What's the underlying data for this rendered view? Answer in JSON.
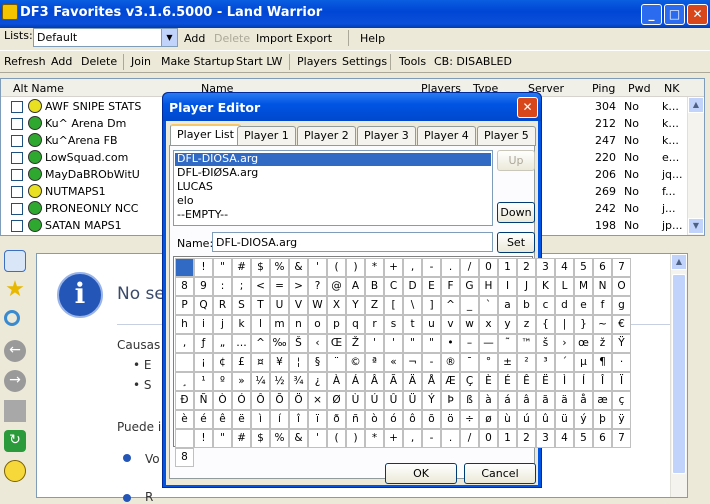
{
  "title": "DF3 Favorites v3.1.6.5000 - Land Warrior",
  "lists": {
    "label": "Lists:",
    "value": "Default",
    "add": "Add",
    "delete": "Delete",
    "import": "Import",
    "export": "Export",
    "help": "Help"
  },
  "toolbar": {
    "refresh": "Refresh",
    "add": "Add",
    "delete": "Delete",
    "join": "Join",
    "make_startup": "Make Startup",
    "start_lw": "Start LW",
    "players": "Players",
    "settings": "Settings",
    "tools": "Tools",
    "cb": "CB: DISABLED"
  },
  "columns": {
    "alt": "Alt Name",
    "name": "Name",
    "players": "Players",
    "type": "Type",
    "server": "Server",
    "ping": "Ping",
    "pwd": "Pwd",
    "nk": "NK"
  },
  "servers": [
    {
      "name": "AWF SNIPE STATS",
      "ping": "304",
      "pwd": "No",
      "nk": "k...",
      "status": "#e8e020"
    },
    {
      "name": "Ku^ Arena Dm",
      "ping": "212",
      "pwd": "No",
      "nk": "k...",
      "status": "#2fa82f"
    },
    {
      "name": "Ku^Arena FB",
      "ping": "247",
      "pwd": "No",
      "nk": "k...",
      "status": "#2fa82f"
    },
    {
      "name": "LowSquad.com",
      "ping": "220",
      "pwd": "No",
      "nk": "e...",
      "status": "#2fa82f"
    },
    {
      "name": "MayDaBRObWitU",
      "ping": "206",
      "pwd": "No",
      "nk": "jq...",
      "status": "#2fa82f"
    },
    {
      "name": "NUTMAPS1",
      "ping": "269",
      "pwd": "No",
      "nk": "f...",
      "status": "#e8e020"
    },
    {
      "name": "PRONEONLY NCC",
      "ping": "242",
      "pwd": "No",
      "nk": "j...",
      "status": "#2fa82f"
    },
    {
      "name": "SATAN MAPS1",
      "ping": "198",
      "pwd": "No",
      "nk": "jp...",
      "status": "#2fa82f"
    }
  ],
  "content": {
    "heading": "No se",
    "causas": "Causas",
    "b1": "E",
    "b2": "S",
    "puede": "Puede i",
    "vo": "Vo",
    "bottom": "R"
  },
  "dialog": {
    "title": "Player Editor",
    "tabs": [
      "Player List",
      "Player 1",
      "Player 2",
      "Player 3",
      "Player 4",
      "Player 5"
    ],
    "players": [
      "DFL-DIOSA.arg",
      "DFL-ÐIØSA.arg",
      "LUCAS",
      "elo",
      "--EMPTY--"
    ],
    "up": "Up",
    "down": "Down",
    "name_label": "Name:",
    "name_value": "DFL-DIOSA.arg",
    "set": "Set",
    "ok": "OK",
    "cancel": "Cancel",
    "chars": [
      " ",
      "!",
      "\"",
      "#",
      "$",
      "%",
      "&",
      "'",
      "(",
      ")",
      "*",
      "+",
      ",",
      "-",
      ".",
      "/",
      "0",
      "1",
      "2",
      "3",
      "4",
      "5",
      "6",
      "7",
      "8",
      "9",
      ":",
      ";",
      "<",
      "=",
      ">",
      "?",
      "@",
      "A",
      "B",
      "C",
      "D",
      "E",
      "F",
      "G",
      "H",
      "I",
      "J",
      "K",
      "L",
      "M",
      "N",
      "O",
      "P",
      "Q",
      "R",
      "S",
      "T",
      "U",
      "V",
      "W",
      "X",
      "Y",
      "Z",
      "[",
      "\\",
      "]",
      "^",
      "_",
      "`",
      "a",
      "b",
      "c",
      "d",
      "e",
      "f",
      "g",
      "h",
      "i",
      "j",
      "k",
      "l",
      "m",
      "n",
      "o",
      "p",
      "q",
      "r",
      "s",
      "t",
      "u",
      "v",
      "w",
      "x",
      "y",
      "z",
      "{",
      "|",
      "}",
      "~",
      "€",
      ",",
      "ƒ",
      "„",
      "…",
      "^",
      "‰",
      "Š",
      "‹",
      "Œ",
      "Ž",
      "'",
      "'",
      "\"",
      "\"",
      "•",
      "–",
      "—",
      "˜",
      "™",
      "š",
      "›",
      "œ",
      "ž",
      "Ÿ",
      " ",
      "¡",
      "¢",
      "£",
      "¤",
      "¥",
      "¦",
      "§",
      "¨",
      "©",
      "ª",
      "«",
      "¬",
      "-",
      "®",
      "¯",
      "°",
      "±",
      "²",
      "³",
      "´",
      "µ",
      "¶",
      "·",
      "¸",
      "¹",
      "º",
      "»",
      "¼",
      "½",
      "¾",
      "¿",
      "À",
      "Á",
      "Â",
      "Ã",
      "Ä",
      "Å",
      "Æ",
      "Ç",
      "È",
      "É",
      "Ê",
      "Ë",
      "Ì",
      "Í",
      "Î",
      "Ï",
      "Ð",
      "Ñ",
      "Ò",
      "Ó",
      "Ô",
      "Õ",
      "Ö",
      "×",
      "Ø",
      "Ù",
      "Ú",
      "Û",
      "Ü",
      "Ý",
      "Þ",
      "ß",
      "à",
      "á",
      "â",
      "ã",
      "ä",
      "å",
      "æ",
      "ç",
      "è",
      "é",
      "ê",
      "ë",
      "ì",
      "í",
      "î",
      "ï",
      "ð",
      "ñ",
      "ò",
      "ó",
      "ô",
      "õ",
      "ö",
      "÷",
      "ø",
      "ù",
      "ú",
      "û",
      "ü",
      "ý",
      "þ",
      "ÿ",
      " ",
      "!",
      "\"",
      "#",
      "$",
      "%",
      "&",
      "'",
      "(",
      ")",
      "*",
      "+",
      ",",
      "-",
      ".",
      "/",
      "0",
      "1",
      "2",
      "3",
      "4",
      "5",
      "6",
      "7",
      "8"
    ]
  }
}
